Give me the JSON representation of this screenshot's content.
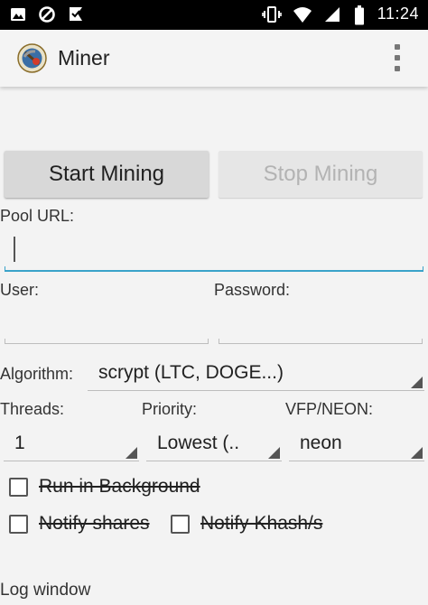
{
  "status_bar": {
    "time": "11:24",
    "left_icons": [
      "image-icon",
      "data-saver-icon",
      "checkmark-flag-icon"
    ],
    "right_icons": [
      "vibrate-icon",
      "wifi-icon",
      "signal-icon",
      "battery-icon"
    ]
  },
  "toolbar": {
    "title": "Miner",
    "app_icon": "miner-app-icon",
    "overflow_icon": "more-vert-icon"
  },
  "buttons": {
    "start_label": "Start Mining",
    "stop_label": "Stop Mining"
  },
  "form": {
    "pool_url_label": "Pool URL:",
    "pool_url_value": "",
    "user_label": "User:",
    "user_value": "",
    "password_label": "Password:",
    "password_value": "",
    "algorithm_label": "Algorithm:",
    "algorithm_value": "scrypt (LTC, DOGE...)",
    "threads_label": "Threads:",
    "threads_value": "1",
    "priority_label": "Priority:",
    "priority_value": "Lowest (..",
    "vfp_label": "VFP/NEON:",
    "vfp_value": "neon"
  },
  "checkboxes": {
    "run_background": "Run in Background",
    "notify_shares": "Notify shares",
    "notify_khash": "Notify Khash/s"
  },
  "log": {
    "label": "Log window"
  },
  "colors": {
    "accent": "#3aa3c9",
    "status_bar": "#000000",
    "toolbar": "#f4f4f4",
    "disabled_text": "#b3b3b3"
  }
}
